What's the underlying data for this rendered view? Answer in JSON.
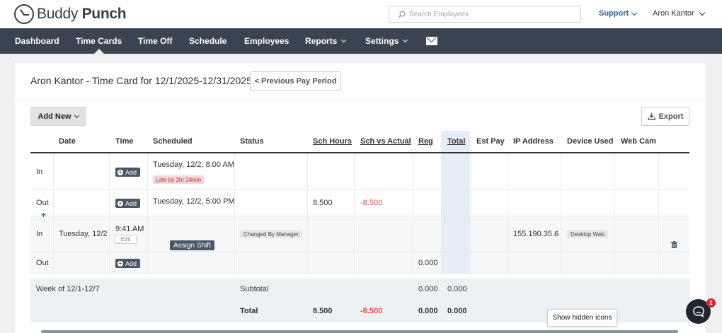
{
  "header": {
    "logo_word1": "Buddy",
    "logo_word2": "Punch",
    "search_placeholder": "Search Employees",
    "support_label": "Support",
    "user_name": "Aron Kantor"
  },
  "nav": {
    "items": [
      {
        "label": "Dashboard"
      },
      {
        "label": "Time Cards"
      },
      {
        "label": "Time Off"
      },
      {
        "label": "Schedule"
      },
      {
        "label": "Employees"
      },
      {
        "label": "Reports"
      },
      {
        "label": "Settings"
      }
    ],
    "active": "Time Cards",
    "mail_icon": "envelope-icon"
  },
  "page": {
    "title": "Aron Kantor - Time Card for 12/1/2025-12/31/2025",
    "prev_period_label": "< Previous Pay Period",
    "add_new_label": "Add New",
    "export_label": "Export"
  },
  "table": {
    "headers": [
      "Date",
      "Time",
      "Scheduled",
      "Status",
      "Sch Hours",
      "Sch vs Actual",
      "Reg",
      "Total",
      "Est Pay",
      "IP Address",
      "Device Used",
      "Web Cam"
    ],
    "shift1": {
      "in_label": "In",
      "in_add": "Add",
      "in_scheduled": "Tuesday, 12/2, 8:00 AM",
      "late_badge": "Late by 2hr 24min",
      "out_label": "Out",
      "out_add": "Add",
      "out_scheduled": "Tuesday, 12/2, 5:00 PM",
      "sch_hours": "8.500",
      "sch_vs_actual": "-8.500",
      "add_row_icon": "+"
    },
    "shift2": {
      "in_label": "In",
      "date": "Tuesday, 12/2",
      "in_time": "9:41 AM",
      "edit_label": "Edit",
      "assign_label": "Assign Shift",
      "status": "Changed By Manager",
      "ip": "155.190.35.6",
      "device": "Desktop Web",
      "out_label": "Out",
      "out_add": "Add",
      "reg": "0.000"
    },
    "week": {
      "label": "Week of 12/1-12/7",
      "subtotal_label": "Subtotal",
      "subtotal_reg": "0.000",
      "subtotal_total": "0.000"
    },
    "grand_total": {
      "label": "Total",
      "sch_hours": "8.500",
      "sch_vs_actual": "-8.500",
      "reg": "0.000",
      "total": "0.000"
    }
  },
  "tooltip": "Show hidden icons",
  "chat": {
    "badge": "2"
  },
  "colors": {
    "nav_bg": "#3a4350",
    "accent_link": "#2b5d8a",
    "negative": "#d9534f",
    "late_bg": "#f9d6d9",
    "total_col": "#e5eef7"
  }
}
